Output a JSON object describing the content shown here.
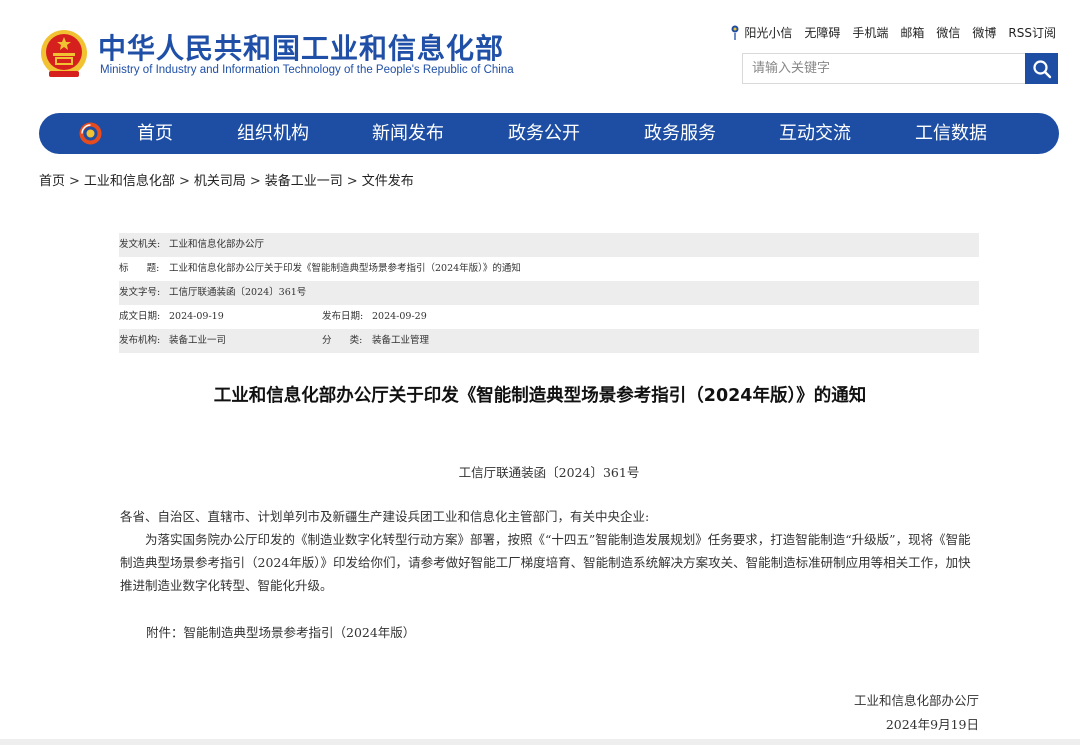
{
  "header": {
    "title_cn": "中华人民共和国工业和信息化部",
    "title_en": "Ministry of Industry and Information Technology of the People's Republic of China",
    "emblem_icon": "national-emblem-icon",
    "top_links": [
      "阳光小信",
      "无障碍",
      "手机端",
      "邮箱",
      "微信",
      "微博",
      "RSS订阅"
    ],
    "search_placeholder": "请输入关键字",
    "search_icon": "search-icon"
  },
  "colors": {
    "brand_blue": "#1d4ea3",
    "title_blue": "#1f4fa6",
    "emblem_red": "#d6201e",
    "emblem_gold": "#f1c232",
    "meta_shade": "#ededed"
  },
  "nav": {
    "items": [
      "首页",
      "组织机构",
      "新闻发布",
      "政务公开",
      "政务服务",
      "互动交流",
      "工信数据"
    ]
  },
  "breadcrumb": {
    "items": [
      "首页",
      "工业和信息化部",
      "机关司局",
      "装备工业一司",
      "文件发布"
    ],
    "separator": ">"
  },
  "meta": {
    "issuer_label": "发文机关:",
    "issuer": "工业和信息化部办公厅",
    "title_label": "标      题:",
    "title": "工业和信息化部办公厅关于印发《智能制造典型场景参考指引（2024年版）》的通知",
    "doc_no_label": "发文字号:",
    "doc_no": "工信厅联通装函〔2024〕361号",
    "written_label": "成文日期:",
    "written_date": "2024-09-19",
    "published_label": "发布日期:",
    "published_date": "2024-09-29",
    "org_label": "发布机构:",
    "org": "装备工业一司",
    "category_label": "分      类:",
    "category": "装备工业管理"
  },
  "article": {
    "title": "工业和信息化部办公厅关于印发《智能制造典型场景参考指引（2024年版）》的通知",
    "doc_number": "工信厅联通装函〔2024〕361号",
    "salutation": "各省、自治区、直辖市、计划单列市及新疆生产建设兵团工业和信息化主管部门，有关中央企业:",
    "paragraph": "为落实国务院办公厅印发的《制造业数字化转型行动方案》部署，按照《“十四五”智能制造发展规划》任务要求，打造智能制造“升级版”，现将《智能制造典型场景参考指引（2024年版）》印发给你们，请参考做好智能工厂梯度培育、智能制造系统解决方案攻关、智能制造标准研制应用等相关工作，加快推进制造业数字化转型、智能化升级。",
    "attachment": "附件：智能制造典型场景参考指引（2024年版）",
    "signer": "工业和信息化部办公厅",
    "sign_date": "2024年9月19日"
  }
}
